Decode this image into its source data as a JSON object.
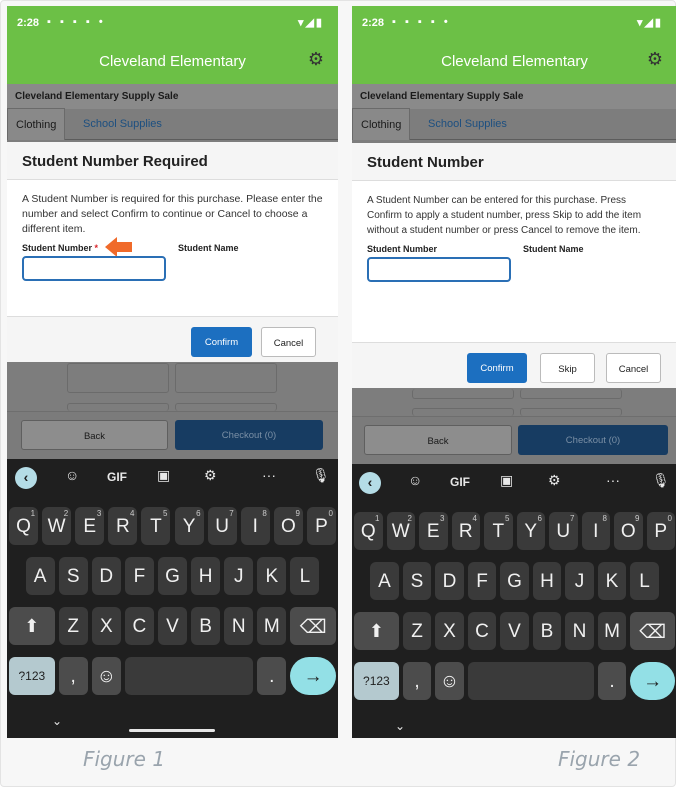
{
  "status_time": "2:28",
  "app_title": "Cleveland Elementary",
  "sale_title": "Cleveland Elementary Supply Sale",
  "tabs": [
    "Clothing",
    "School Supplies"
  ],
  "figure1": {
    "caption": "Figure 1",
    "dialog_title": "Student Number Required",
    "dialog_text": "A Student Number is required for this purchase. Please enter the number and select Confirm to continue or Cancel to choose a different item.",
    "student_number_label": "Student Number",
    "required_marker": "*",
    "student_name_label": "Student Name",
    "student_number_value": "",
    "buttons": {
      "confirm": "Confirm",
      "cancel": "Cancel"
    },
    "bottom": {
      "back": "Back",
      "checkout": "Checkout (0)"
    }
  },
  "figure2": {
    "caption": "Figure 2",
    "dialog_title": "Student Number",
    "dialog_text": "A Student Number can be entered for this purchase. Press Confirm to apply a student number, press Skip to add the item without a student number or press Cancel to remove the item.",
    "student_number_label": "Student Number",
    "student_name_label": "Student Name",
    "student_number_value": "",
    "buttons": {
      "confirm": "Confirm",
      "skip": "Skip",
      "cancel": "Cancel"
    },
    "bottom": {
      "back": "Back",
      "checkout": "Checkout (0)"
    }
  },
  "keyboard": {
    "toolbar": [
      "back-icon",
      "sticker-icon",
      "GIF",
      "translate-icon",
      "gear-icon",
      "...",
      "mic-icon"
    ],
    "gif_label": "GIF",
    "more_label": "···",
    "row1": [
      "Q",
      "W",
      "E",
      "R",
      "T",
      "Y",
      "U",
      "I",
      "O",
      "P"
    ],
    "row1_hints": [
      "1",
      "2",
      "3",
      "4",
      "5",
      "6",
      "7",
      "8",
      "9",
      "0"
    ],
    "row2": [
      "A",
      "S",
      "D",
      "F",
      "G",
      "H",
      "J",
      "K",
      "L"
    ],
    "row3": [
      "Z",
      "X",
      "C",
      "V",
      "B",
      "N",
      "M"
    ],
    "num_key": "?123",
    "comma_key": ",",
    "period_key": ".",
    "enter_glyph": "→",
    "shift_glyph": "⬆",
    "backspace_glyph": "⌫",
    "emoji_glyph": "☺"
  },
  "colors": {
    "app_green": "#6cc046",
    "primary_blue": "#1c6fc0",
    "required_red": "#d9252a",
    "arrow_orange": "#f06a2a"
  }
}
